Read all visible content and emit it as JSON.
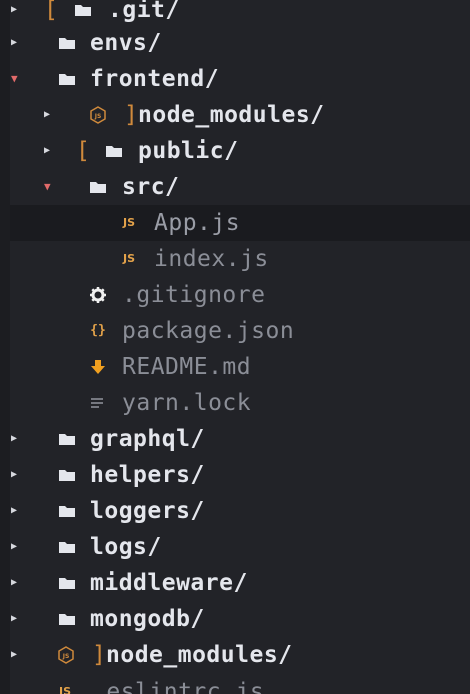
{
  "tree": {
    "rows": [
      {
        "name": ".git/",
        "kind": "folder",
        "expanded": false,
        "icon": "folder-icon"
      },
      {
        "name": "envs/",
        "kind": "folder",
        "expanded": false,
        "icon": "folder-icon"
      },
      {
        "name": "frontend/",
        "kind": "folder",
        "expanded": true,
        "icon": "folder-icon"
      },
      {
        "name": "node_modules/",
        "kind": "folder",
        "expanded": false,
        "icon": "nodejs-icon"
      },
      {
        "name": "public/",
        "kind": "folder",
        "expanded": false,
        "icon": "folder-icon"
      },
      {
        "name": "src/",
        "kind": "folder",
        "expanded": true,
        "icon": "folder-icon"
      },
      {
        "name": "App.js",
        "kind": "file",
        "icon": "js-icon",
        "selected": true
      },
      {
        "name": "index.js",
        "kind": "file",
        "icon": "js-icon"
      },
      {
        "name": ".gitignore",
        "kind": "file",
        "icon": "gear-icon"
      },
      {
        "name": "package.json",
        "kind": "file",
        "icon": "json-icon"
      },
      {
        "name": "README.md",
        "kind": "file",
        "icon": "download-arrow-icon"
      },
      {
        "name": "yarn.lock",
        "kind": "file",
        "icon": "lines-icon"
      },
      {
        "name": "graphql/",
        "kind": "folder",
        "expanded": false,
        "icon": "folder-icon"
      },
      {
        "name": "helpers/",
        "kind": "folder",
        "expanded": false,
        "icon": "folder-icon"
      },
      {
        "name": "loggers/",
        "kind": "folder",
        "expanded": false,
        "icon": "folder-icon"
      },
      {
        "name": "logs/",
        "kind": "folder",
        "expanded": false,
        "icon": "folder-icon"
      },
      {
        "name": "middleware/",
        "kind": "folder",
        "expanded": false,
        "icon": "folder-icon"
      },
      {
        "name": "mongodb/",
        "kind": "folder",
        "expanded": false,
        "icon": "folder-icon"
      },
      {
        "name": "node_modules/",
        "kind": "folder",
        "expanded": false,
        "icon": "nodejs-icon"
      },
      {
        "name": ".eslintrc.js",
        "kind": "file",
        "icon": "js-icon"
      }
    ]
  },
  "colors": {
    "background": "#222328",
    "folder_text": "#e4e6ec",
    "file_text": "#8b8e97",
    "accent_orange": "#e3a24a",
    "expanded_arrow": "#e26a6a"
  }
}
